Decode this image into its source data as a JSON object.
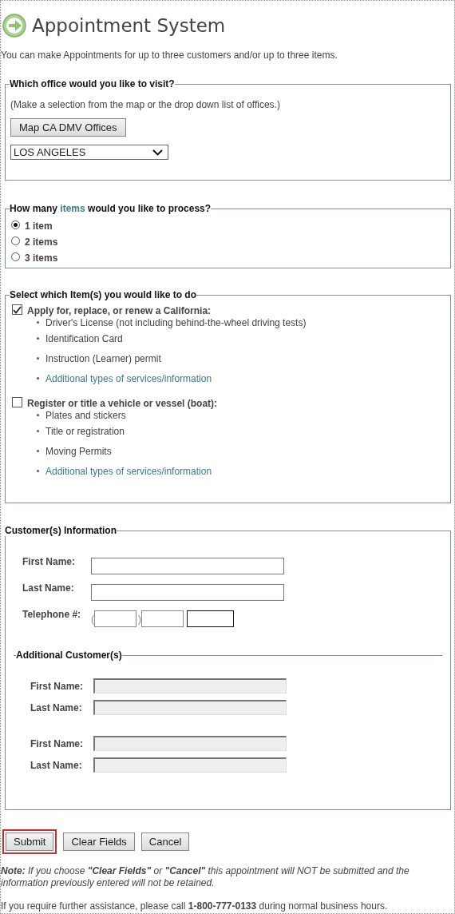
{
  "title": "Appointment System",
  "intro": "You can make Appointments for up to three customers and/or up to three items.",
  "office": {
    "legend": "Which office would you like to visit?",
    "hint": "(Make a selection from the map or the drop down list of offices.)",
    "map_button": "Map CA DMV Offices",
    "selection": "LOS ANGELES"
  },
  "item_count": {
    "legend": [
      {
        "text": "How many ",
        "kind": "text"
      },
      {
        "text": "items",
        "kind": "link"
      },
      {
        "text": " would you like to process?",
        "kind": "text"
      }
    ],
    "options": [
      {
        "label": "1 item",
        "selected": true
      },
      {
        "label": "2 items",
        "selected": false
      },
      {
        "label": "3 items",
        "selected": false
      }
    ]
  },
  "services": {
    "legend": "Select which Item(s) you would like to do",
    "groups": [
      {
        "label": "Apply for, replace, or renew a California:",
        "checked": true,
        "entries": [
          {
            "text": "Driver's License (not including behind-the-wheel driving tests)",
            "kind": "text"
          },
          {
            "text": "Identification Card",
            "kind": "text"
          },
          {
            "text": "Instruction (Learner) permit",
            "kind": "text"
          },
          {
            "text": "Additional types of services/information",
            "kind": "link"
          }
        ]
      },
      {
        "label": "Register or title a vehicle or vessel (boat):",
        "checked": false,
        "entries": [
          {
            "text": "Plates and stickers",
            "kind": "text"
          },
          {
            "text": "Title or registration",
            "kind": "text"
          },
          {
            "text": "Moving Permits",
            "kind": "text"
          },
          {
            "text": "Additional types of services/information",
            "kind": "link"
          }
        ]
      }
    ]
  },
  "customers": {
    "legend": "Customer(s) Information",
    "fields": [
      {
        "label": "First Name:",
        "disabled": false
      },
      {
        "label": "Last Name:",
        "disabled": false
      }
    ],
    "phone": {
      "label": "Telephone #:",
      "open_paren": "(",
      "close_paren": ")",
      "parts": [
        {
          "focused": false
        },
        {
          "focused": false
        },
        {
          "focused": true
        }
      ]
    },
    "additional": {
      "legend": "Additional Customer(s)",
      "groups": [
        [
          {
            "label": "First Name:",
            "disabled": true
          },
          {
            "label": "Last Name:",
            "disabled": true
          }
        ],
        [
          {
            "label": "First Name:",
            "disabled": true
          },
          {
            "label": "Last Name:",
            "disabled": true
          }
        ]
      ]
    }
  },
  "buttons": [
    {
      "label": "Submit",
      "highlighted": true
    },
    {
      "label": "Clear Fields",
      "highlighted": false
    },
    {
      "label": "Cancel",
      "highlighted": false
    }
  ],
  "note": "**Note:** If you choose **\"Clear Fields\"** or **\"Cancel\"** this appointment will NOT be submitted and the information previously entered will not be retained.",
  "contact": "If you require further assistance, please call **1-800-777-0133** during normal business hours."
}
